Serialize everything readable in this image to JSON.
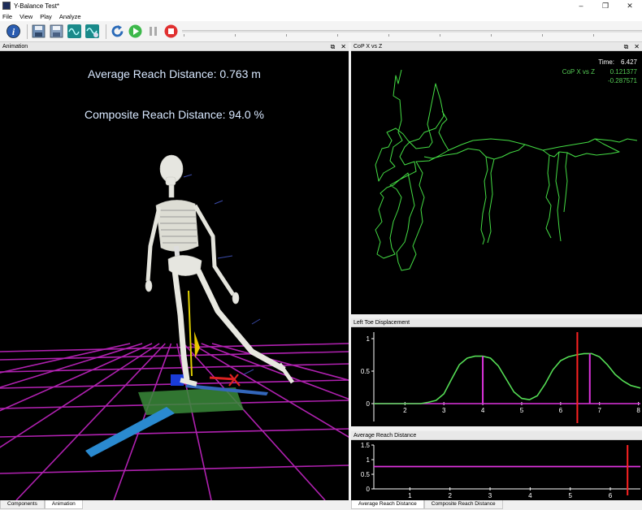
{
  "window": {
    "title": "Y-Balance Test*",
    "minimize": "–",
    "restore": "❐",
    "close": "✕"
  },
  "menu": [
    "File",
    "View",
    "Play",
    "Analyze"
  ],
  "toolbar": {
    "icons": [
      "info-icon",
      "save-icon",
      "save-as-icon",
      "waveform-icon",
      "waveform-settings-icon",
      "rewind-icon",
      "play-icon",
      "pause-icon",
      "stop-icon"
    ]
  },
  "colors": {
    "cop_trace": "#44dd44",
    "cop_label": "#55cc55",
    "toe_curve": "#55dd55",
    "reach_line": "#dd33dd",
    "time_marker": "#ff2222",
    "grid": "#cc22cc"
  },
  "animation_panel": {
    "title": "Animation",
    "average_reach": "Average Reach Distance: 0.763 m",
    "composite_reach": "Composite Reach Distance: 94.0 %",
    "tabs": [
      "Components",
      "Animation"
    ],
    "active_tab": "Animation"
  },
  "cop_panel": {
    "title": "CoP X vs Z",
    "time_label": "Time:",
    "time_value": "6.427",
    "series_label": "CoP X vs Z",
    "x_value": "0.121377",
    "z_value": "-0.287571"
  },
  "toe_panel": {
    "title": "Left Toe Displacement"
  },
  "reach_panel": {
    "title": "Average Reach Distance",
    "tabs": [
      "Average Reach Distance",
      "Composite Reach Distance"
    ],
    "active_tab": "Average Reach Distance"
  },
  "chart_data": [
    {
      "type": "line",
      "title": "Left Toe Displacement",
      "xlabel": "",
      "ylabel": "",
      "xlim": [
        1.2,
        8.05
      ],
      "ylim": [
        -0.3,
        1.1
      ],
      "xticks": [
        "2",
        "3",
        "4",
        "5",
        "6",
        "7",
        "8"
      ],
      "yticks": [
        "0",
        "0.5",
        "1"
      ],
      "grid": false,
      "series": [
        {
          "x": [
            1.2,
            2.0,
            2.4,
            2.6,
            2.8,
            3.0,
            3.2,
            3.4,
            3.6,
            3.8,
            4.0,
            4.2,
            4.4,
            4.6,
            4.8,
            5.0,
            5.2,
            5.4,
            5.6,
            5.8,
            6.0,
            6.2,
            6.4,
            6.6,
            6.8,
            7.0,
            7.2,
            7.4,
            7.6,
            7.8,
            8.05
          ],
          "y": [
            0.0,
            0.0,
            0.0,
            0.02,
            0.05,
            0.15,
            0.38,
            0.6,
            0.7,
            0.73,
            0.73,
            0.7,
            0.58,
            0.38,
            0.18,
            0.08,
            0.06,
            0.12,
            0.3,
            0.52,
            0.66,
            0.72,
            0.75,
            0.77,
            0.77,
            0.72,
            0.6,
            0.45,
            0.35,
            0.28,
            0.24
          ]
        }
      ],
      "reach_markers": [
        {
          "x": 4.0,
          "y": 0.73
        },
        {
          "x": 6.75,
          "y": 0.77
        }
      ],
      "time_marker": 6.43
    },
    {
      "type": "line",
      "title": "Average Reach Distance",
      "xlabel": "",
      "ylabel": "",
      "xlim": [
        0.1,
        6.75
      ],
      "ylim": [
        0,
        1.5
      ],
      "xticks": [
        "1",
        "2",
        "3",
        "4",
        "5",
        "6"
      ],
      "yticks": [
        "0",
        "0.5",
        "1",
        "1.5"
      ],
      "grid": false,
      "series": [
        {
          "x": [
            0.1,
            6.75
          ],
          "y": [
            0.763,
            0.763
          ]
        }
      ],
      "time_marker": 6.43
    }
  ]
}
